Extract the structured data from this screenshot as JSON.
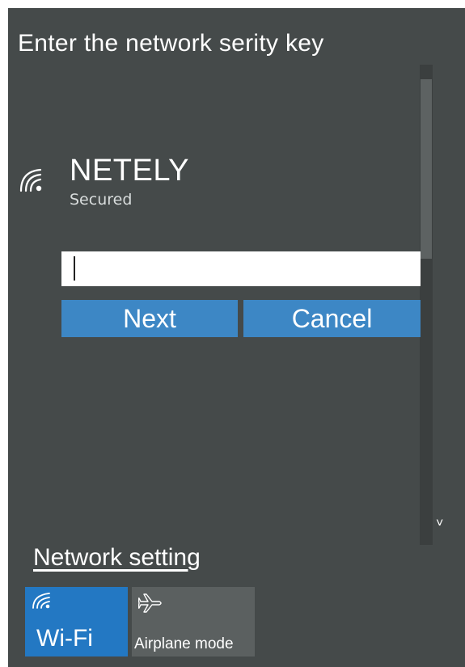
{
  "dialog": {
    "title": "Enter the network serity key"
  },
  "network": {
    "name": "NETELY",
    "status": "Secured",
    "icon": "wifi-icon"
  },
  "key_input": {
    "value": "",
    "placeholder": ""
  },
  "buttons": {
    "next_label": "Next",
    "cancel_label": "Cancel"
  },
  "scrollbar": {
    "down_arrow": "˅"
  },
  "footer": {
    "settings_link": "Network setting",
    "tiles": [
      {
        "label": "Wi-Fi",
        "icon": "wifi-icon",
        "active": true
      },
      {
        "label": "Airplane mode",
        "icon": "airplane-icon",
        "active": false
      }
    ]
  },
  "colors": {
    "panel_bg": "#454a4a",
    "button_bg": "#3d87c5",
    "wifi_tile_active": "#2378c3",
    "airplane_tile": "#5b6060"
  }
}
